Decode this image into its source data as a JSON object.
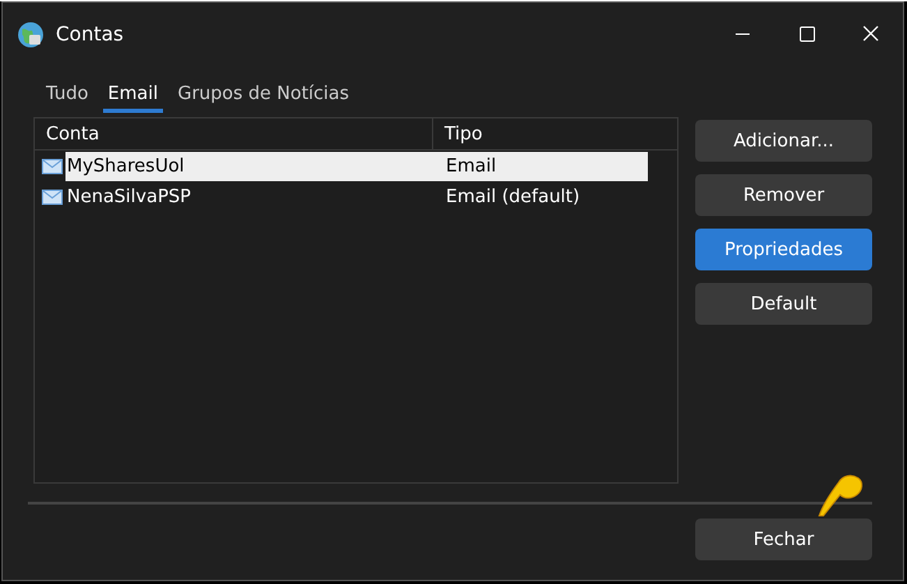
{
  "window": {
    "title": "Contas"
  },
  "tabs": [
    {
      "label": "Tudo",
      "selected": false
    },
    {
      "label": "Email",
      "selected": true
    },
    {
      "label": "Grupos de Notícias",
      "selected": false
    }
  ],
  "table": {
    "columns": [
      "Conta",
      "Tipo"
    ],
    "rows": [
      {
        "name": "MySharesUol",
        "type": "Email",
        "selected": true
      },
      {
        "name": "NenaSilvaPSP",
        "type": "Email (default)",
        "selected": false
      }
    ]
  },
  "buttons": [
    {
      "label": "Adicionar...",
      "highlighted": false
    },
    {
      "label": "Remover",
      "highlighted": false
    },
    {
      "label": "Propriedades",
      "highlighted": true
    },
    {
      "label": "Default",
      "highlighted": false
    }
  ],
  "close_button": {
    "label": "Fechar"
  }
}
